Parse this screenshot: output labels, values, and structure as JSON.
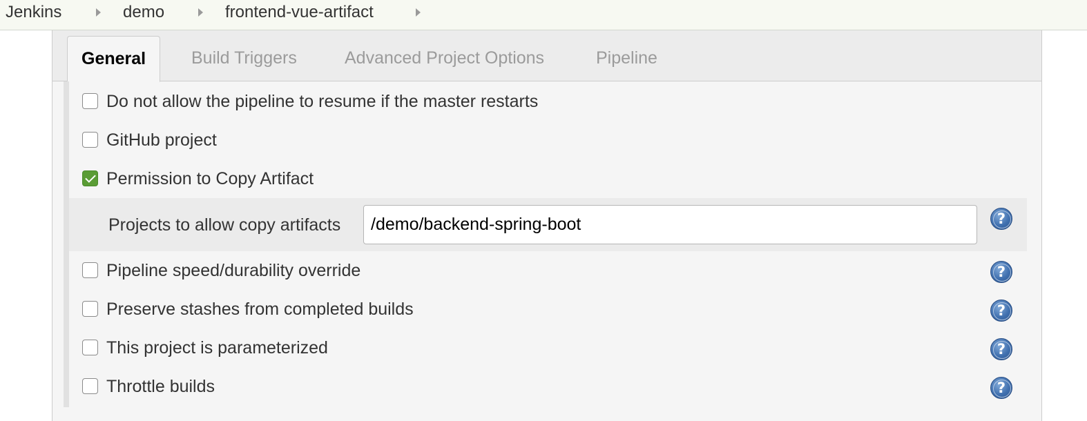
{
  "breadcrumb": {
    "items": [
      "Jenkins",
      "demo",
      "frontend-vue-artifact"
    ]
  },
  "tabs": [
    {
      "label": "General",
      "active": true
    },
    {
      "label": "Build Triggers",
      "active": false
    },
    {
      "label": "Advanced Project Options",
      "active": false
    },
    {
      "label": "Pipeline",
      "active": false
    }
  ],
  "options": [
    {
      "label": "Do not allow the pipeline to resume if the master restarts",
      "checked": false,
      "help": false
    },
    {
      "label": "GitHub project",
      "checked": false,
      "help": false
    },
    {
      "label": "Permission to Copy Artifact",
      "checked": true,
      "help": false
    },
    {
      "label": "Pipeline speed/durability override",
      "checked": false,
      "help": true
    },
    {
      "label": "Preserve stashes from completed builds",
      "checked": false,
      "help": true
    },
    {
      "label": "This project is parameterized",
      "checked": false,
      "help": true
    },
    {
      "label": "Throttle builds",
      "checked": false,
      "help": true
    }
  ],
  "copy_artifact": {
    "label": "Projects to allow copy artifacts",
    "value": "/demo/backend-spring-boot"
  },
  "icons": {
    "breadcrumb_separator": "caret-right-icon",
    "help": "help-icon",
    "checkbox_checked": "checkmark-icon"
  },
  "colors": {
    "checked_checkbox": "#5a9c35",
    "help_icon": "#3f6fae",
    "breadcrumb_bg": "#f7f9f2",
    "panel_bg": "#f5f5f5"
  }
}
